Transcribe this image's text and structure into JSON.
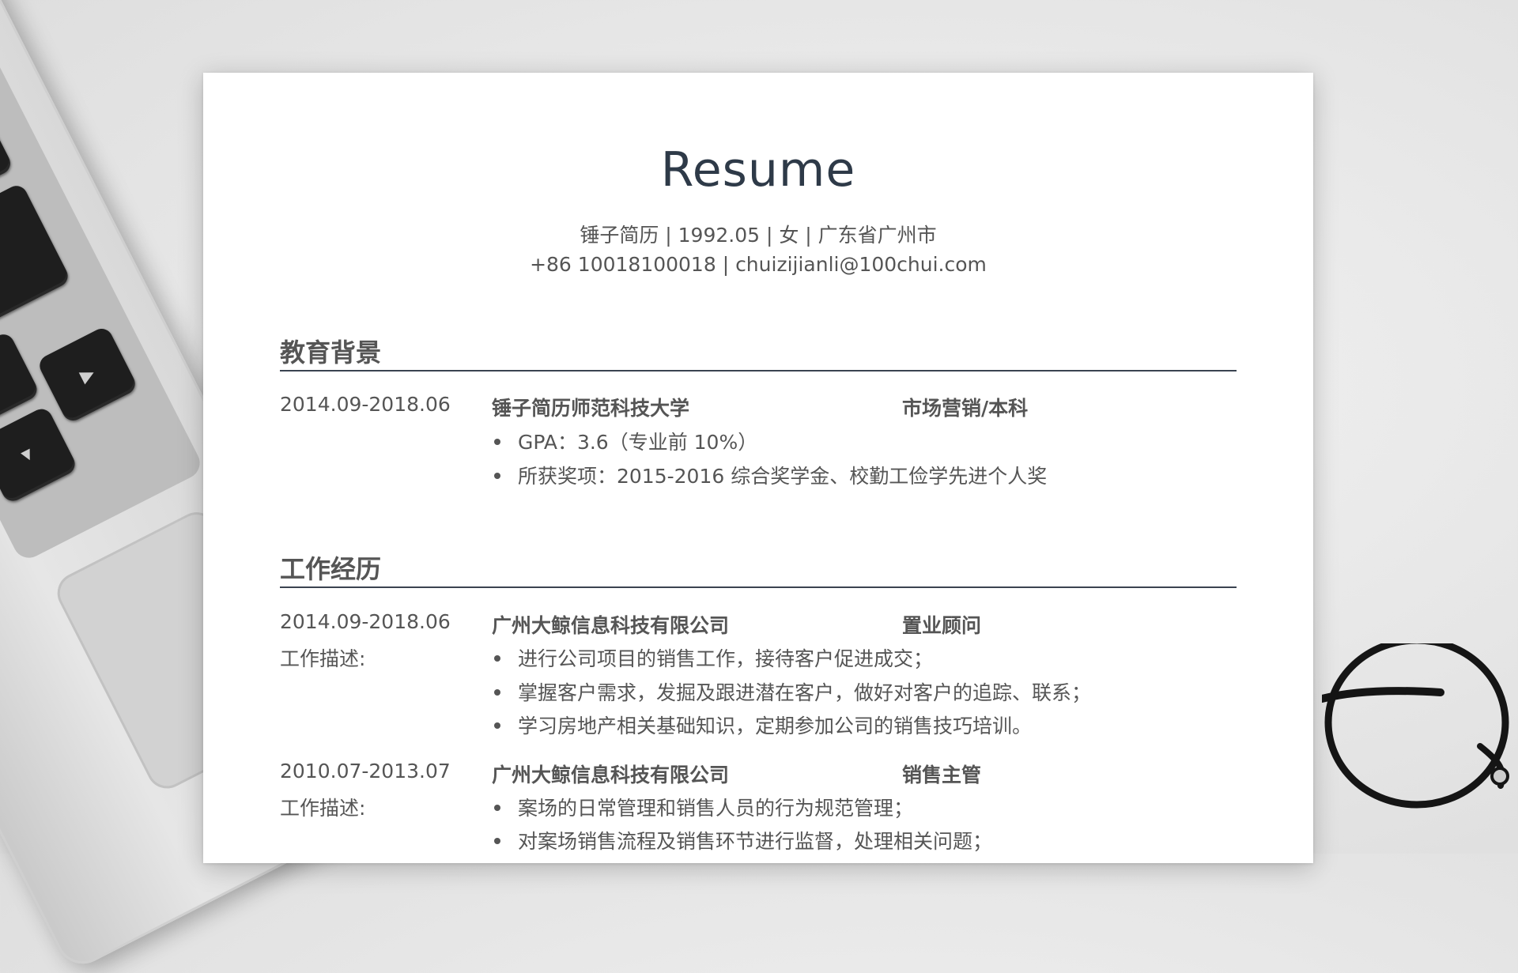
{
  "resume": {
    "title": "Resume",
    "info_line1": "锤子简历 | 1992.05 | 女 | 广东省广州市",
    "info_line2": "+86 10018100018 | chuizijianli@100chui.com"
  },
  "education": {
    "heading": "教育背景",
    "entry": {
      "dates": "2014.09-2018.06",
      "school": "锤子简历师范科技大学",
      "major": "市场营销/本科",
      "bullets": [
        "GPA：3.6（专业前 10%）",
        "所获奖项：2015-2016 综合奖学金、校勤工俭学先进个人奖"
      ]
    }
  },
  "work": {
    "heading": "工作经历",
    "jobs": [
      {
        "dates": "2014.09-2018.06",
        "company": "广州大鲸信息科技有限公司",
        "role": "置业顾问",
        "desc_label": "工作描述:",
        "bullets": [
          "进行公司项目的销售工作，接待客户促进成交；",
          "掌握客户需求，发掘及跟进潜在客户，做好对客户的追踪、联系；",
          "学习房地产相关基础知识，定期参加公司的销售技巧培训。"
        ]
      },
      {
        "dates": "2010.07-2013.07",
        "company": "广州大鲸信息科技有限公司",
        "role": "销售主管",
        "desc_label": "工作描述:",
        "bullets": [
          "案场的日常管理和销售人员的行为规范管理；",
          "对案场销售流程及销售环节进行监督，处理相关问题；"
        ]
      }
    ]
  }
}
